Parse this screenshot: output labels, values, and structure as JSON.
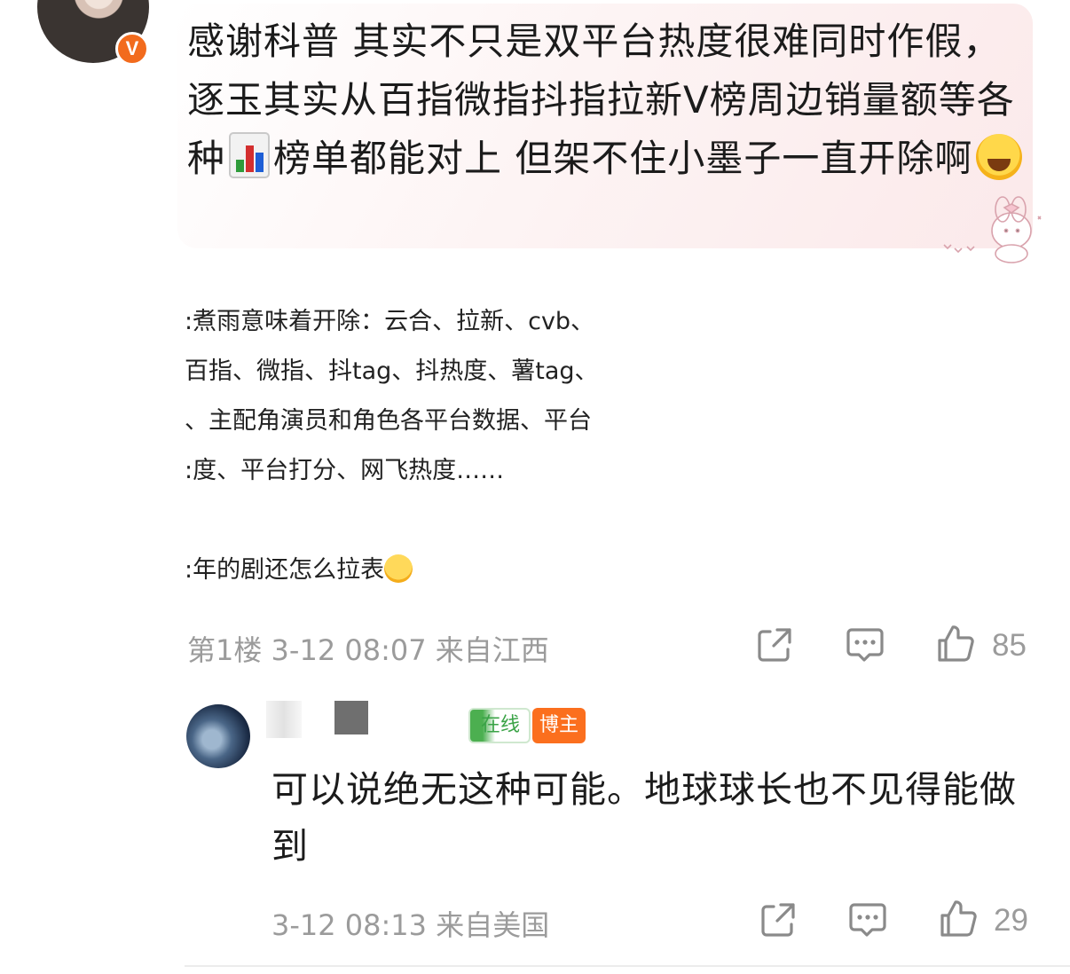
{
  "main_comment": {
    "verified_badge": "V",
    "text_part1": "感谢科普 其实不只是双平台热度很难同时作假，逐玉其实从百指微指抖指拉新V榜周边销量额等各种",
    "chart_emoji": "bar-chart-emoji",
    "text_part2": "榜单都能对上 但架不住小墨子一直开除啊",
    "end_emoji": "laughing-crying-emoji",
    "attached_image": {
      "lines": [
        ":煮雨意味着开除：云合、拉新、cvb、",
        " 百指、微指、抖tag、抖热度、薯tag、",
        "、主配角演员和角色各平台数据、平台",
        ":度、平台打分、网飞热度……",
        ":年的剧还怎么拉表"
      ]
    },
    "floor": "第1楼",
    "time": "3-12 08:07",
    "location": "来自江西",
    "like_count": "85"
  },
  "reply": {
    "badge_online": "在线",
    "badge_blogger": "博主",
    "text": "可以说绝无这种可能。地球球长也不见得能做到",
    "time": "3-12 08:13",
    "location": "来自美国",
    "like_count": "29"
  },
  "colors": {
    "vip_orange": "#f26b1d",
    "blogger_orange": "#fb6f1e",
    "online_green": "#3aa346",
    "meta_gray": "#9b9b9b"
  }
}
